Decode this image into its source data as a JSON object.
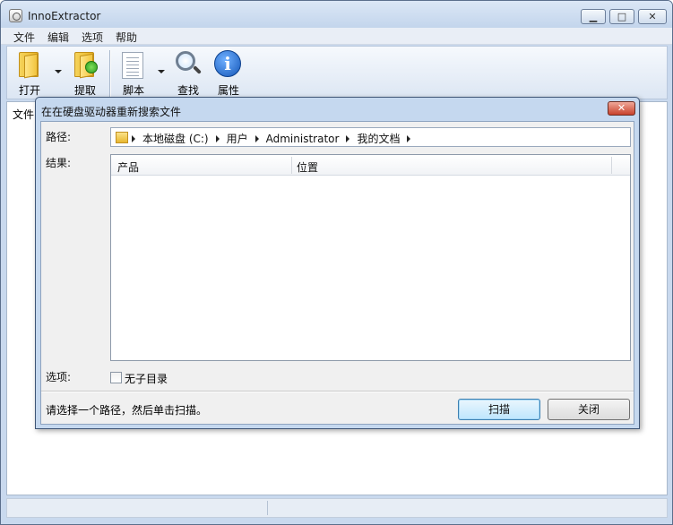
{
  "window": {
    "title": "InnoExtractor"
  },
  "menu": [
    "文件",
    "编辑",
    "选项",
    "帮助"
  ],
  "toolbar": {
    "open": "打开",
    "extract": "提取",
    "script": "脚本",
    "find": "查找",
    "properties": "属性"
  },
  "content": {
    "column_stub": "文件"
  },
  "dialog": {
    "title": "在在硬盘驱动器重新搜索文件",
    "path_label": "路径:",
    "results_label": "结果:",
    "options_label": "选项:",
    "breadcrumbs": [
      "本地磁盘 (C:)",
      "用户",
      "Administrator",
      "我的文档"
    ],
    "columns": [
      "产品",
      "位置"
    ],
    "no_subdir_label": "无子目录",
    "status": "请选择一个路径，然后单击扫描。",
    "scan_button": "扫描",
    "close_button": "关闭"
  }
}
